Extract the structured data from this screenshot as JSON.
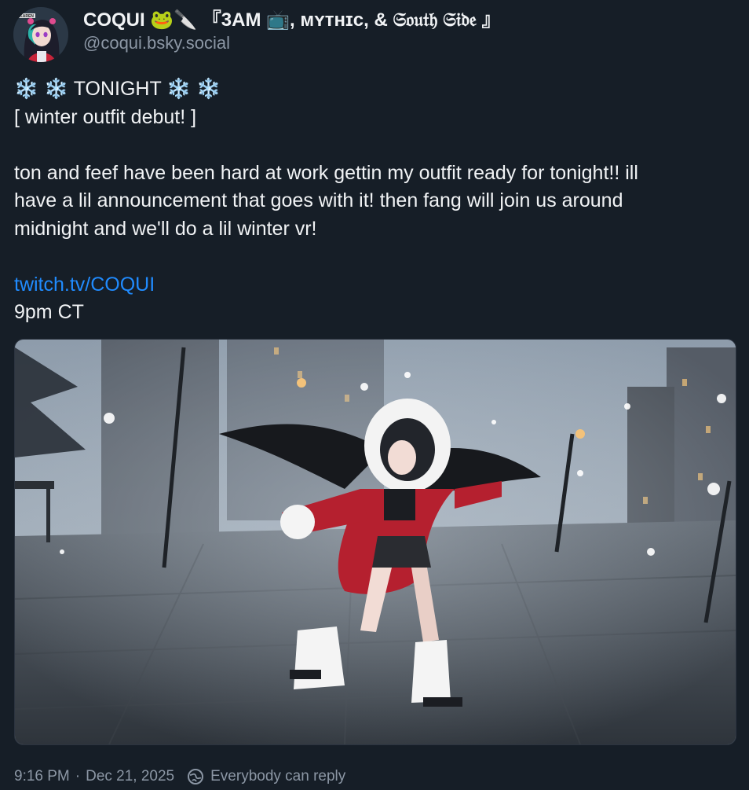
{
  "author": {
    "display_name": "COQUI 🐸🔪 『3AM 📺, ᴍʏᴛʜɪᴄ, & 𝔖𝔬𝔲𝔱𝔥 𝔖𝔦𝔡𝔢 』",
    "handle": "@coqui.bsky.social",
    "avatar_text": "KAREN"
  },
  "post": {
    "lines": {
      "heading": "❄️ ❄️ TONIGHT ❄️ ❄️",
      "subheading": "[ winter outfit debut! ]",
      "body_1": "ton and feef have been hard at work gettin my outfit ready for tonight!! ill",
      "body_2": "have a lil announcement that goes with it! then fang will join us around",
      "body_3": "midnight and we'll do a lil winter vr!",
      "link": "twitch.tv/COQUI",
      "time_note": "9pm CT"
    }
  },
  "footer": {
    "time": "9:16 PM",
    "separator": "·",
    "date": "Dec 21, 2025",
    "reply_setting": "Everybody can reply"
  },
  "colors": {
    "background": "#161e27",
    "text": "#f1f3f5",
    "muted": "#8c97a5",
    "link": "#208bfe"
  },
  "icons": {
    "reply_setting": "globe-reply-icon"
  }
}
